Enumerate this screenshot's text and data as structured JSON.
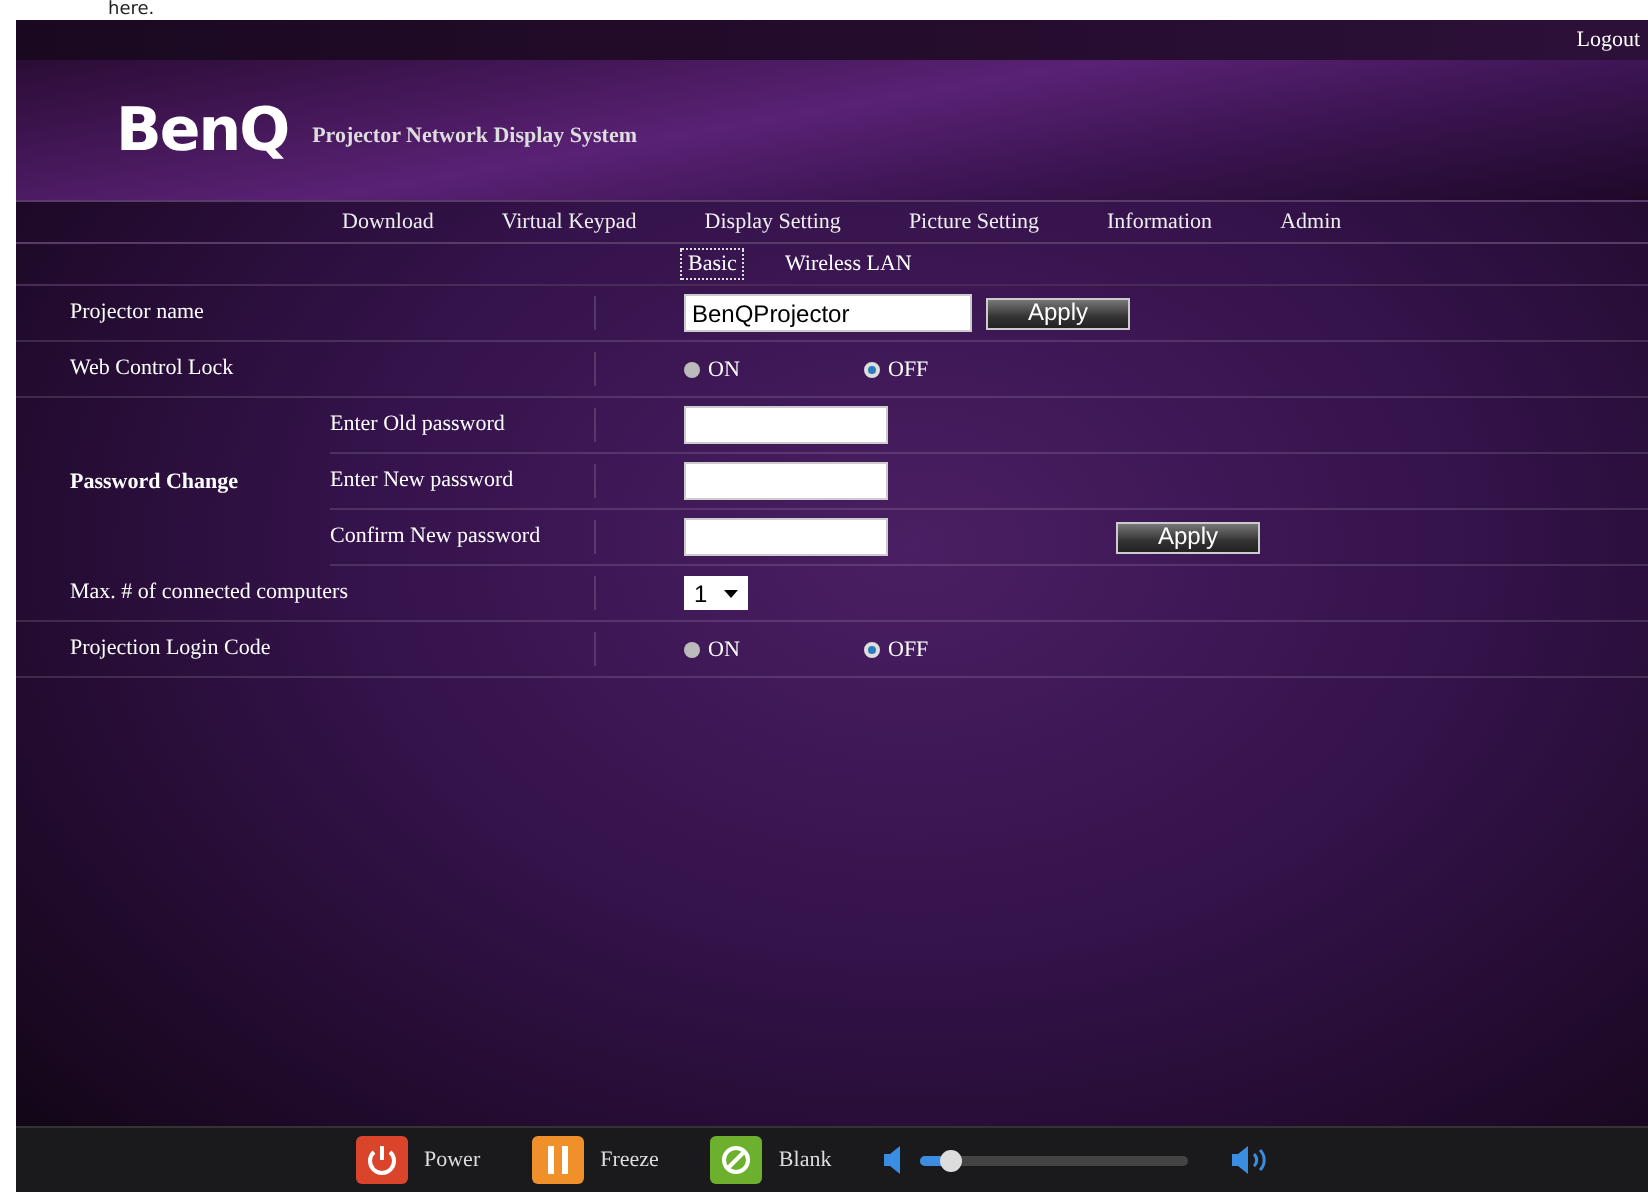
{
  "doc_text": "here.",
  "header": {
    "logo": "BenQ",
    "subtitle": "Projector Network Display System",
    "logout": "Logout"
  },
  "nav": [
    {
      "label": "Download"
    },
    {
      "label": "Virtual Keypad"
    },
    {
      "label": "Display Setting"
    },
    {
      "label": "Picture Setting"
    },
    {
      "label": "Information"
    },
    {
      "label": "Admin"
    }
  ],
  "subtabs": [
    {
      "label": "Basic",
      "selected": true
    },
    {
      "label": "Wireless LAN",
      "selected": false
    }
  ],
  "form": [
    {
      "kind": "text",
      "label": "Projector name",
      "value": "BenQProjector",
      "button": "Apply"
    },
    {
      "kind": "radio",
      "label": "Web Control Lock",
      "options": [
        {
          "label": "ON",
          "selected": false
        },
        {
          "label": "OFF",
          "selected": true
        }
      ]
    },
    {
      "kind": "password",
      "label": "Password Change",
      "fields": [
        {
          "label": "Enter Old password"
        },
        {
          "label": "Enter New password"
        },
        {
          "label": "Confirm New password"
        }
      ],
      "button": "Apply"
    },
    {
      "kind": "select",
      "label": "Max. # of connected computers",
      "value": "1"
    },
    {
      "kind": "radio",
      "label": "Projection Login Code",
      "options": [
        {
          "label": "ON",
          "selected": false
        },
        {
          "label": "OFF",
          "selected": true
        }
      ]
    }
  ],
  "controls": [
    {
      "kind": "power",
      "label": "Power"
    },
    {
      "kind": "freeze",
      "label": "Freeze"
    },
    {
      "kind": "blank",
      "label": "Blank"
    }
  ],
  "volume": {
    "level": 0.12
  }
}
